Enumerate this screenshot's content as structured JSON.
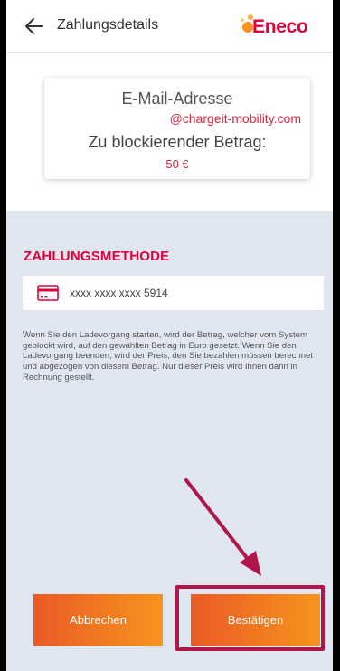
{
  "header": {
    "back_icon": "arrow-left-icon",
    "title": "Zahlungsdetails",
    "logo_text": "Eneco"
  },
  "info_card": {
    "email_label": "E-Mail-Adresse",
    "email_value": "@chargeit-mobility.com",
    "amount_label": "Zu blockierender Betrag:",
    "amount_value": "50 €"
  },
  "payment": {
    "section_title": "ZAHLUNGSMETHODE",
    "card_icon": "credit-card-icon",
    "card_number": "xxxx xxxx xxxx 5914"
  },
  "info_text": "Wenn Sie den Ladevorgang starten, wird der Betrag, welcher vom System geblockt wird, auf den gewählten Betrag in Euro gesetzt. Wenn Sie den Ladevorgang beenden, wird der Preis, den Sie bezahlen müssen berechnet und abgezogen von diesem Betrag. Nur dieser Preis wird Ihnen dann in Rechnung gestellt.",
  "buttons": {
    "cancel_label": "Abbrechen",
    "confirm_label": "Bestätigen"
  },
  "colors": {
    "accent_red": "#e4003a",
    "button_gradient_start": "#ea5a25",
    "button_gradient_end": "#f7941d",
    "annotation": "#b0164a",
    "background": "#e0e6f0"
  }
}
